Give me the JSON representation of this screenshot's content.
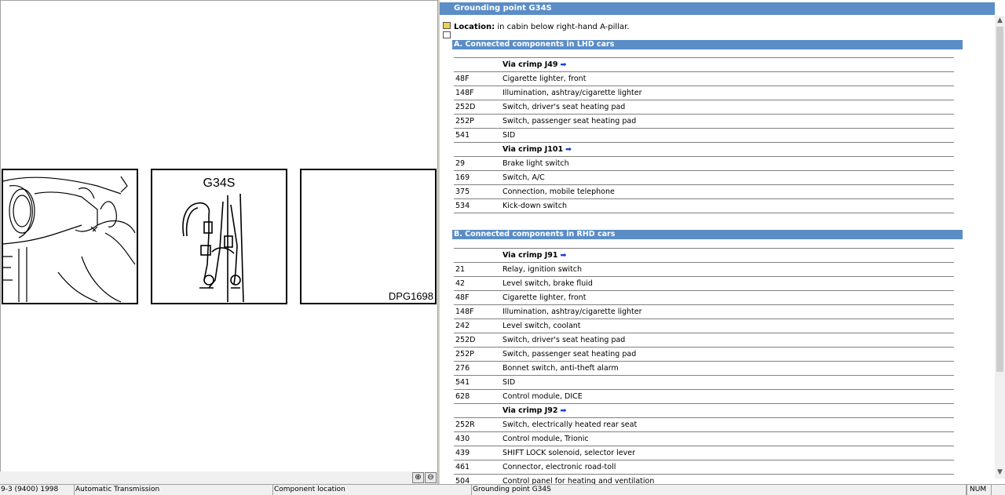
{
  "illustration": {
    "component_label": "G34S",
    "figure_id": "DPG1698"
  },
  "page": {
    "title": "Grounding point G34S",
    "location_label": "Location:",
    "location_text": "in cabin below right-hand A-pillar."
  },
  "section_a": {
    "title": "A. Connected components in LHD cars",
    "rows": [
      {
        "code": "",
        "desc": "Via crimp J49",
        "crimp": true
      },
      {
        "code": "48F",
        "desc": "Cigarette lighter, front"
      },
      {
        "code": "148F",
        "desc": "Illumination, ashtray/cigarette lighter"
      },
      {
        "code": "252D",
        "desc": "Switch, driver's seat heating pad"
      },
      {
        "code": "252P",
        "desc": "Switch, passenger seat heating pad"
      },
      {
        "code": "541",
        "desc": "SID"
      },
      {
        "code": "",
        "desc": "Via crimp J101",
        "crimp": true
      },
      {
        "code": "29",
        "desc": "Brake light switch"
      },
      {
        "code": "169",
        "desc": "Switch, A/C"
      },
      {
        "code": "375",
        "desc": "Connection, mobile telephone"
      },
      {
        "code": "534",
        "desc": "Kick-down switch"
      }
    ]
  },
  "section_b": {
    "title": "B. Connected components in RHD cars",
    "rows": [
      {
        "code": "",
        "desc": "Via crimp J91",
        "crimp": true
      },
      {
        "code": "21",
        "desc": "Relay, ignition switch"
      },
      {
        "code": "42",
        "desc": "Level switch, brake fluid"
      },
      {
        "code": "48F",
        "desc": "Cigarette lighter, front"
      },
      {
        "code": "148F",
        "desc": "Illumination, ashtray/cigarette lighter"
      },
      {
        "code": "242",
        "desc": "Level switch, coolant"
      },
      {
        "code": "252D",
        "desc": "Switch, driver's seat heating pad"
      },
      {
        "code": "252P",
        "desc": "Switch, passenger seat heating pad"
      },
      {
        "code": "276",
        "desc": "Bonnet switch, anti-theft alarm"
      },
      {
        "code": "541",
        "desc": "SID"
      },
      {
        "code": "628",
        "desc": "Control module, DICE"
      },
      {
        "code": "",
        "desc": "Via crimp J92",
        "crimp": true
      },
      {
        "code": "252R",
        "desc": "Switch, electrically heated rear seat"
      },
      {
        "code": "430",
        "desc": "Control module, Trionic"
      },
      {
        "code": "439",
        "desc": "SHIFT LOCK solenoid, selector lever"
      },
      {
        "code": "461",
        "desc": "Connector, electronic road-toll"
      },
      {
        "code": "504",
        "desc": "Control panel for heating and ventilation"
      }
    ]
  },
  "status_bar": {
    "model": "9-3 (9400) 1998",
    "system": "Automatic Transmission",
    "category": "Component location",
    "item": "Grounding point G34S",
    "num": "NUM"
  },
  "icons": {
    "zoom_in": "zoom-in-icon",
    "zoom_out": "zoom-out-icon",
    "crimp_link": "right-arrow-icon"
  },
  "colors": {
    "header_blue": "#5b8dc6",
    "link_arrow": "#1a3fd8"
  }
}
